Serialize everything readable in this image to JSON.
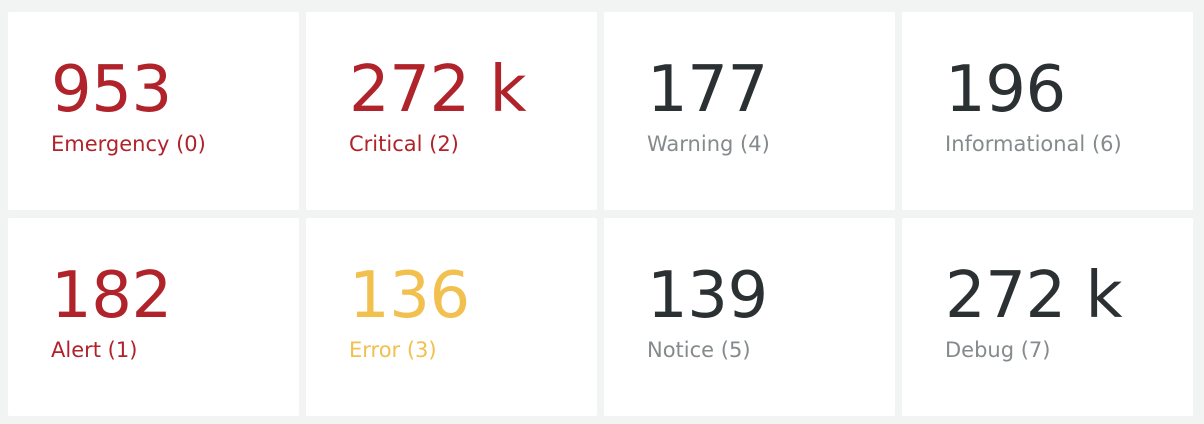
{
  "tiles": [
    {
      "value": "953",
      "label": "Emergency (0)",
      "color": "#b1232b"
    },
    {
      "value": "272 k",
      "label": "Critical (2)",
      "color": "#b1232b"
    },
    {
      "value": "177",
      "label": "Warning (4)",
      "color": "#2b3133"
    },
    {
      "value": "196",
      "label": "Informational (6)",
      "color": "#2b3133"
    },
    {
      "value": "182",
      "label": "Alert (1)",
      "color": "#b1232b"
    },
    {
      "value": "136",
      "label": "Error (3)",
      "color": "#f1c04f"
    },
    {
      "value": "139",
      "label": "Notice (5)",
      "color": "#2b3133"
    },
    {
      "value": "272 k",
      "label": "Debug (7)",
      "color": "#2b3133"
    }
  ]
}
